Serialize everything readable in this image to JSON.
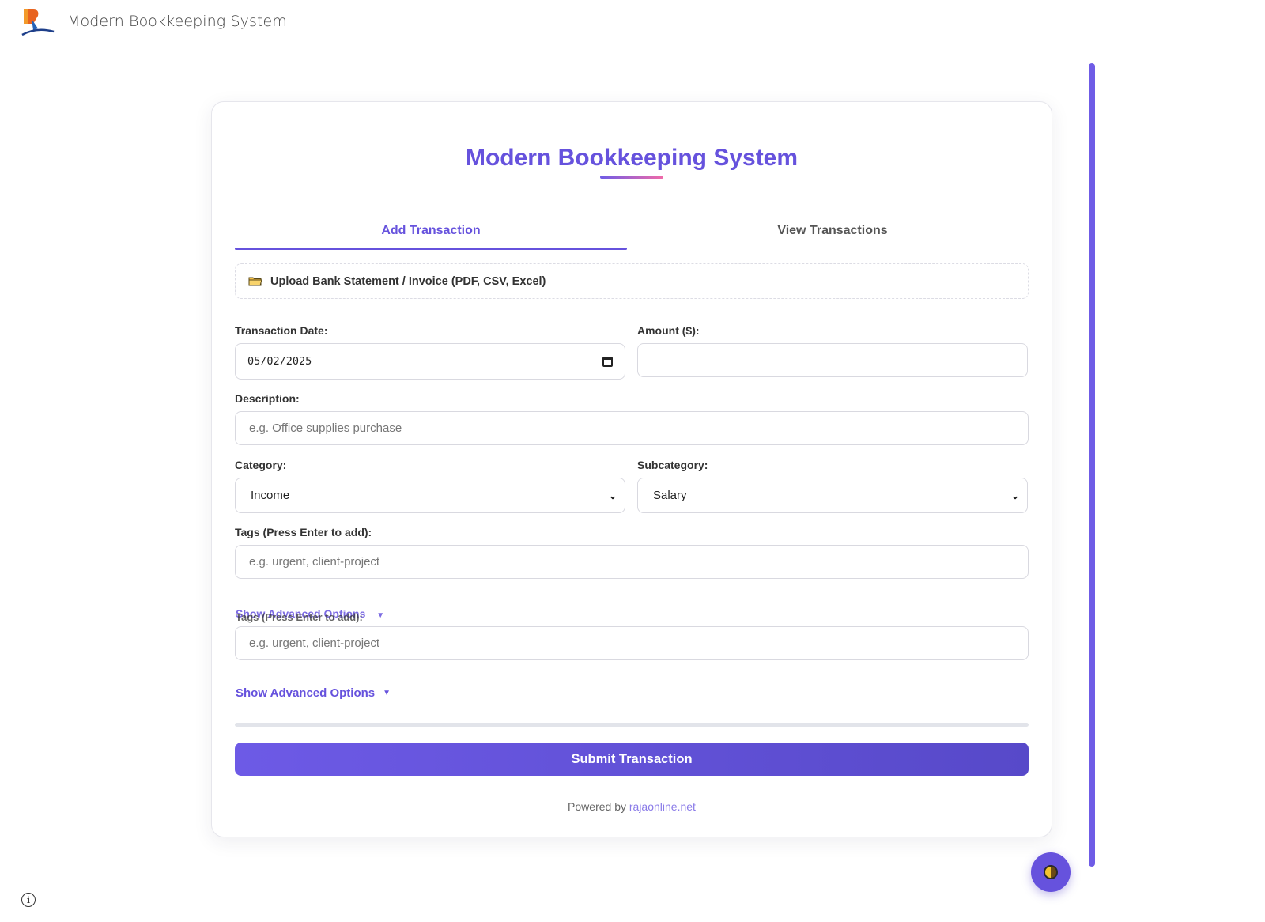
{
  "app": {
    "title": "Modern Bookkeeping System"
  },
  "card": {
    "title": "Modern Bookkeeping System"
  },
  "tabs": [
    {
      "label": "Add Transaction",
      "active": true
    },
    {
      "label": "View Transactions",
      "active": false
    }
  ],
  "upload": {
    "label": "Upload Bank Statement / Invoice (PDF, CSV, Excel)"
  },
  "form": {
    "date": {
      "label": "Transaction Date:",
      "value": "05/02/2025"
    },
    "amount": {
      "label": "Amount ($):",
      "value": ""
    },
    "description": {
      "label": "Description:",
      "placeholder": "e.g. Office supplies purchase"
    },
    "category": {
      "label": "Category:",
      "value": "Income"
    },
    "subcategory": {
      "label": "Subcategory:",
      "value": "Salary"
    },
    "tags": {
      "label": "Tags (Press Enter to add):",
      "placeholder": "e.g. urgent, client-project"
    },
    "tags_duplicate": {
      "label": "Tags (Press Enter to add):",
      "placeholder": "e.g. urgent, client-project"
    },
    "advanced_overlap": "Show Advanced Options",
    "advanced": "Show Advanced Options",
    "advanced_arrow": "▼",
    "submit": "Submit Transaction"
  },
  "footer": {
    "powered_prefix": "Powered by",
    "powered_link": "rajaonline.net"
  },
  "colors": {
    "accent": "#6652dd",
    "gradient_end": "#f06aa8"
  }
}
